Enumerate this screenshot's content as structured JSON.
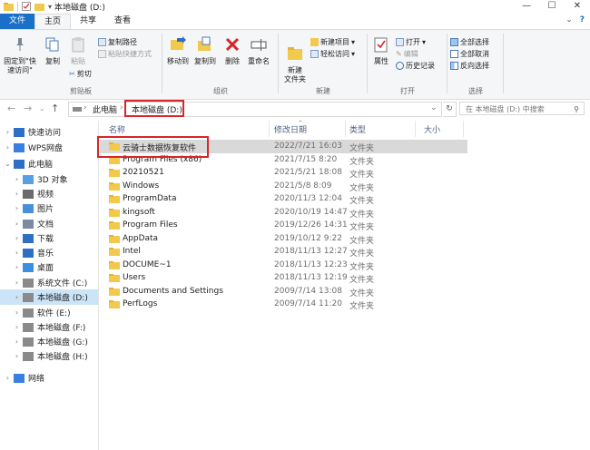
{
  "window": {
    "title": "本地磁盘 (D:)",
    "controls": [
      "—",
      "☐",
      "✕"
    ]
  },
  "tabs": [
    {
      "label": "文件"
    },
    {
      "label": "主页"
    },
    {
      "label": "共享"
    },
    {
      "label": "查看"
    }
  ],
  "ribbon": {
    "clipboard": {
      "pin_label": "固定到\"快速访问\"",
      "copy_label": "复制",
      "paste_label": "粘贴",
      "cut_label": "剪切",
      "copy_path_label": "复制路径",
      "paste_shortcut_label": "粘贴快捷方式",
      "group_label": "剪贴板"
    },
    "organize": {
      "move_to_label": "移动到",
      "copy_to_label": "复制到",
      "delete_label": "删除",
      "rename_label": "重命名",
      "group_label": "组织"
    },
    "new": {
      "new_folder_label": "新建\n文件夹",
      "new_item_label": "新建项目",
      "easy_access_label": "轻松访问",
      "group_label": "新建"
    },
    "open": {
      "properties_label": "属性",
      "open_label": "打开",
      "edit_label": "编辑",
      "history_label": "历史记录",
      "group_label": "打开"
    },
    "select": {
      "select_all_label": "全部选择",
      "select_none_label": "全部取消",
      "invert_label": "反向选择",
      "group_label": "选择"
    }
  },
  "address": {
    "crumb1": "此电脑",
    "crumb2": "本地磁盘 (D:)",
    "search_placeholder": "在 本地磁盘 (D:) 中搜索"
  },
  "nav": [
    {
      "label": "快速访问",
      "level": 0,
      "chev": "›"
    },
    {
      "label": "WPS网盘",
      "level": 0,
      "chev": "›"
    },
    {
      "label": "此电脑",
      "level": 0,
      "chev": "⌄"
    },
    {
      "label": "3D 对象",
      "level": 1,
      "chev": "›"
    },
    {
      "label": "视频",
      "level": 1,
      "chev": "›"
    },
    {
      "label": "图片",
      "level": 1,
      "chev": "›"
    },
    {
      "label": "文档",
      "level": 1,
      "chev": "›"
    },
    {
      "label": "下载",
      "level": 1,
      "chev": "›"
    },
    {
      "label": "音乐",
      "level": 1,
      "chev": "›"
    },
    {
      "label": "桌面",
      "level": 1,
      "chev": "›"
    },
    {
      "label": "系统文件 (C:)",
      "level": 1,
      "chev": "›"
    },
    {
      "label": "本地磁盘 (D:)",
      "level": 1,
      "chev": "›",
      "selected": true
    },
    {
      "label": "软件 (E:)",
      "level": 1,
      "chev": "›"
    },
    {
      "label": "本地磁盘 (F:)",
      "level": 1,
      "chev": "›"
    },
    {
      "label": "本地磁盘 (G:)",
      "level": 1,
      "chev": "›"
    },
    {
      "label": "本地磁盘 (H:)",
      "level": 1,
      "chev": "›"
    },
    {
      "label": "网络",
      "level": 0,
      "chev": "›"
    }
  ],
  "columns": {
    "name": "名称",
    "date": "修改日期",
    "type": "类型",
    "size": "大小"
  },
  "files": [
    {
      "name": "云骑士数据恢复软件",
      "date": "2022/7/21 16:03",
      "type": "文件夹",
      "selected": true
    },
    {
      "name": "Program Files (x86)",
      "date": "2021/7/15 8:20",
      "type": "文件夹"
    },
    {
      "name": "20210521",
      "date": "2021/5/21 18:08",
      "type": "文件夹"
    },
    {
      "name": "Windows",
      "date": "2021/5/8 8:09",
      "type": "文件夹"
    },
    {
      "name": "ProgramData",
      "date": "2020/11/3 12:04",
      "type": "文件夹"
    },
    {
      "name": "kingsoft",
      "date": "2020/10/19 14:47",
      "type": "文件夹"
    },
    {
      "name": "Program Files",
      "date": "2019/12/26 14:31",
      "type": "文件夹"
    },
    {
      "name": "AppData",
      "date": "2019/10/12 9:22",
      "type": "文件夹"
    },
    {
      "name": "Intel",
      "date": "2018/11/13 12:27",
      "type": "文件夹"
    },
    {
      "name": "DOCUME~1",
      "date": "2018/11/13 12:23",
      "type": "文件夹"
    },
    {
      "name": "Users",
      "date": "2018/11/13 12:19",
      "type": "文件夹"
    },
    {
      "name": "Documents and Settings",
      "date": "2009/7/14 13:08",
      "type": "文件夹"
    },
    {
      "name": "PerfLogs",
      "date": "2009/7/14 11:20",
      "type": "文件夹"
    }
  ]
}
